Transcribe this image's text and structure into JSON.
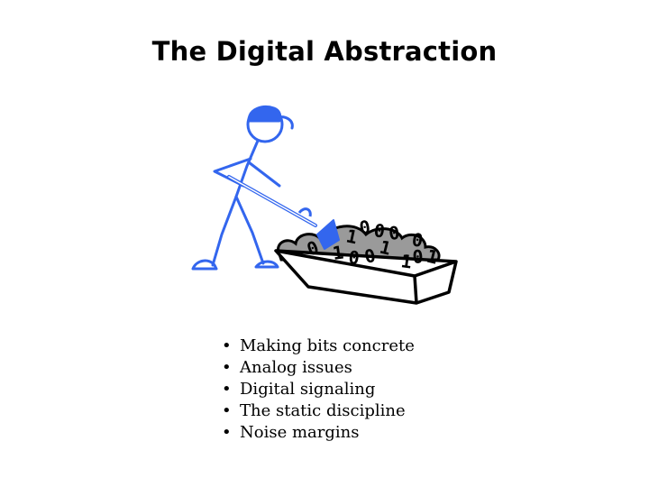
{
  "slide": {
    "title": "The Digital Abstraction",
    "bullets": [
      "Making bits concrete",
      "Analog issues",
      "Digital signaling",
      "The static discipline",
      "Noise margins"
    ],
    "bullet_glyph": "•",
    "illustration": {
      "icon": "stick-figure-shoveling-bits-icon",
      "bits": [
        "1",
        "1",
        "0",
        "0",
        "0",
        "0",
        "1",
        "1",
        "0",
        "0",
        "1",
        "0",
        "1",
        "0"
      ],
      "colors": {
        "figure": "#3366ee",
        "pile": "#9a9a9a",
        "outline": "#000000"
      }
    }
  }
}
